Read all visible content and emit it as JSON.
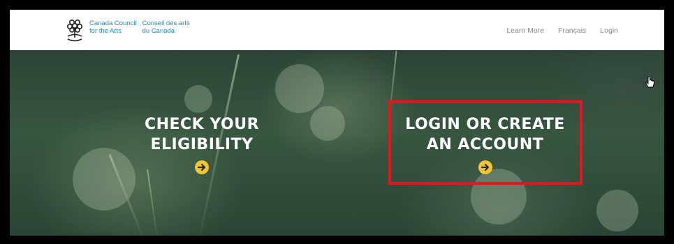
{
  "logo": {
    "english_line1": "Canada Council",
    "english_line2": "for the Arts",
    "french_line1": "Conseil des arts",
    "french_line2": "du Canada",
    "icon": "tree-logo-icon"
  },
  "nav": {
    "learn_more": "Learn More",
    "francais": "Français",
    "login": "Login"
  },
  "hero": {
    "check_eligibility": {
      "line1": "CHECK YOUR",
      "line2": "ELIGIBILITY",
      "icon": "arrow-right-circle-icon"
    },
    "login_create": {
      "line1": "LOGIN OR CREATE",
      "line2": "AN ACCOUNT",
      "icon": "arrow-right-circle-icon"
    }
  },
  "colors": {
    "brand_blue": "#1f8fb8",
    "accent_yellow": "#f2c530",
    "highlight_red": "#e8141b"
  }
}
